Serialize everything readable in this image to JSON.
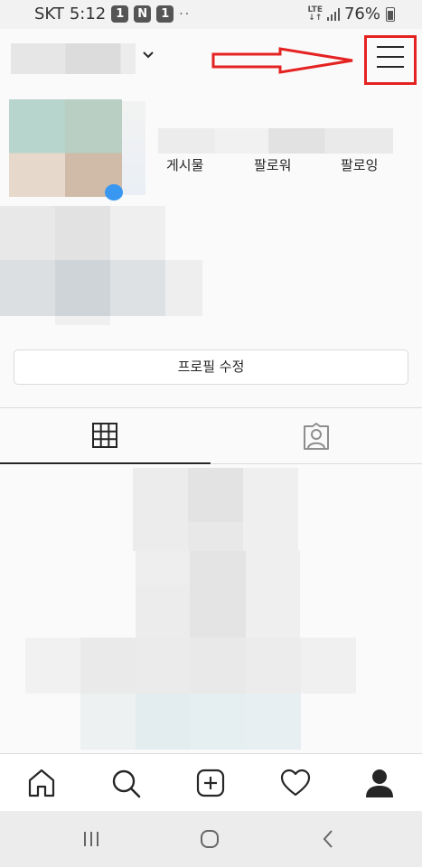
{
  "status_bar": {
    "carrier": "SKT",
    "time": "5:12",
    "notif_1": "1",
    "notif_2": "1",
    "dots": "··",
    "network": "LTE",
    "battery": "76%"
  },
  "header": {
    "username": "",
    "dropdown_icon": "chevron-down-icon",
    "menu_icon": "hamburger-menu-icon",
    "annotation_color": "#e52222"
  },
  "profile": {
    "stats": [
      {
        "label": "게시물"
      },
      {
        "label": "팔로워"
      },
      {
        "label": "팔로잉"
      }
    ],
    "edit_profile_label": "프로필 수정"
  },
  "tabs": [
    {
      "icon": "grid-icon",
      "selected": true
    },
    {
      "icon": "tagged-person-icon",
      "selected": false
    }
  ],
  "bottom_nav": [
    {
      "icon": "home-icon"
    },
    {
      "icon": "search-icon"
    },
    {
      "icon": "add-post-icon"
    },
    {
      "icon": "heart-icon"
    },
    {
      "icon": "profile-icon",
      "selected": true
    }
  ],
  "system_nav": [
    {
      "icon": "recent-apps-icon"
    },
    {
      "icon": "home-circle-icon"
    },
    {
      "icon": "back-icon"
    }
  ]
}
